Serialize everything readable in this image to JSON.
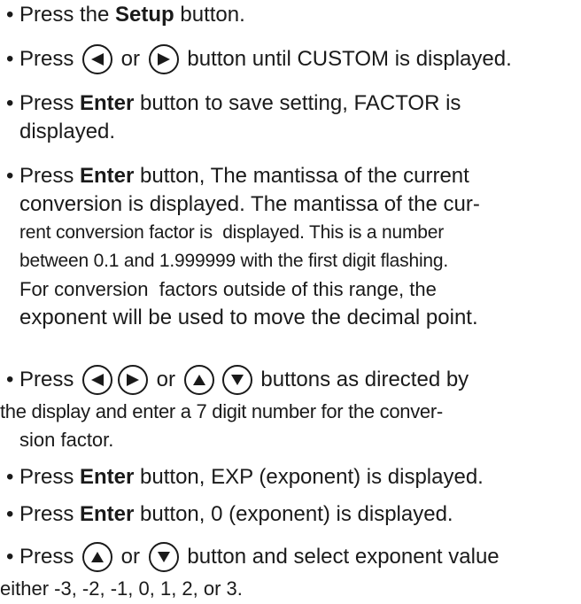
{
  "bullet": "•",
  "item1": {
    "pre": "Press the ",
    "bold": "Setup",
    "post": " button."
  },
  "item2": {
    "pre": "Press ",
    "or": " or ",
    "post": " button until CUSTOM is displayed."
  },
  "item3": {
    "pre": "Press ",
    "bold": "Enter",
    "post": " button to save setting, FACTOR is",
    "line2": "displayed."
  },
  "item4": {
    "pre": "Press ",
    "bold": "Enter",
    "post": " button, The mantissa of the current",
    "line2": "conversion is displayed. The mantissa of the cur-",
    "line3": "rent conversion factor is  displayed. This is a number",
    "line4": "between 0.1 and 1.999999 with the first digit flashing.",
    "line5": "For conversion  factors outside of this range, the",
    "line6": "exponent will be used to move the decimal point."
  },
  "item5": {
    "pre": "Press ",
    "or": " or ",
    "post": " buttons as directed by",
    "line2": "the display and enter a 7 digit number for the conver-",
    "line3": "sion factor."
  },
  "item6": {
    "pre": "Press ",
    "bold": "Enter",
    "post": " button, EXP (exponent) is displayed."
  },
  "item7": {
    "pre": "Press ",
    "bold": "Enter",
    "post": " button, 0 (exponent) is displayed."
  },
  "item8": {
    "pre": "Press ",
    "or": " or ",
    "post": " button and select exponent value",
    "line2": "either -3, -2, -1, 0, 1, 2, or 3."
  },
  "icons": [
    "left-arrow-button-icon",
    "right-arrow-button-icon",
    "up-arrow-button-icon",
    "down-arrow-button-icon"
  ]
}
